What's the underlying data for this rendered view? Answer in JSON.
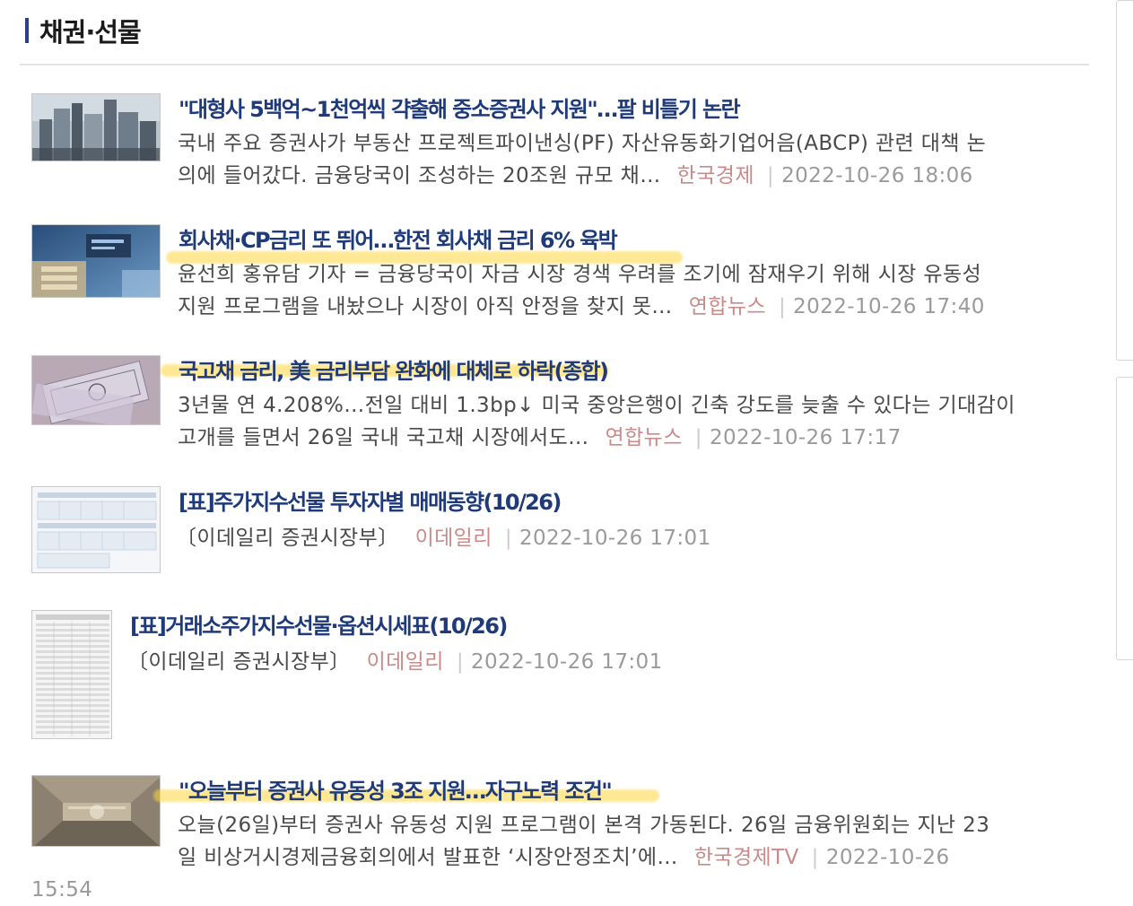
{
  "section": {
    "title": "채권·선물"
  },
  "articles": [
    {
      "headline": "\"대형사 5백억~1천억씩 갹출해 중소증권사 지원\"…팔 비틀기 논란",
      "summary_line1": "국내 주요 증권사가 부동산 프로젝트파이낸싱(PF) 자산유동화기업어음(ABCP) 관련 대책 논",
      "summary_line2": "의에 들어갔다. 금융당국이 조성하는 20조원 규모 채…",
      "source": "한국경제",
      "separator": "|",
      "date": "2022-10-26 18:06"
    },
    {
      "headline": "회사채·CP금리 또 뛰어…한전 회사채 금리 6% 육박",
      "summary_line1": "윤선희 홍유담 기자 = 금융당국이 자금 시장 경색 우려를 조기에 잠재우기 위해 시장 유동성",
      "summary_line2": "지원 프로그램을 내놨으나 시장이 아직 안정을 찾지 못…",
      "source": "연합뉴스",
      "separator": "|",
      "date": "2022-10-26 17:40"
    },
    {
      "headline": "국고채 금리, 美 금리부담 완화에 대체로 하락(종합)",
      "summary_line1": "3년물 연 4.208%…전일 대비 1.3bp↓ 미국 중앙은행이 긴축 강도를 늦출 수 있다는 기대감이",
      "summary_line2": "고개를 들면서 26일 국내 국고채 시장에서도…",
      "source": "연합뉴스",
      "separator": "|",
      "date": "2022-10-26 17:17"
    },
    {
      "headline": "[표]주가지수선물 투자자별 매매동향(10/26)",
      "summary_line1": "〔이데일리 증권시장부〕",
      "source": "이데일리",
      "separator": "|",
      "date": "2022-10-26 17:01"
    },
    {
      "headline": "[표]거래소주가지수선물·옵션시세표(10/26)",
      "summary_line1": "〔이데일리 증권시장부〕",
      "source": "이데일리",
      "separator": "|",
      "date": "2022-10-26 17:01"
    },
    {
      "headline": "\"오늘부터 증권사 유동성 3조 지원…자구노력 조건\"",
      "summary_line1": "오늘(26일)부터 증권사 유동성 지원 프로그램이 본격 가동된다. 26일 금융위원회는 지난 23",
      "summary_line2": "일 비상거시경제금융회의에서 발표한 ‘시장안정조치’에…",
      "source": "한국경제TV",
      "separator": "|",
      "date": "2022-10-26",
      "time_wrapped": "15:54"
    }
  ],
  "colors": {
    "headline": "#1f3a7a",
    "summary": "#4a4a4a",
    "source": "#c98a8a",
    "date": "#9a9a9a",
    "accent_bar": "#2b3f8a",
    "highlight": "#ffd63c"
  }
}
